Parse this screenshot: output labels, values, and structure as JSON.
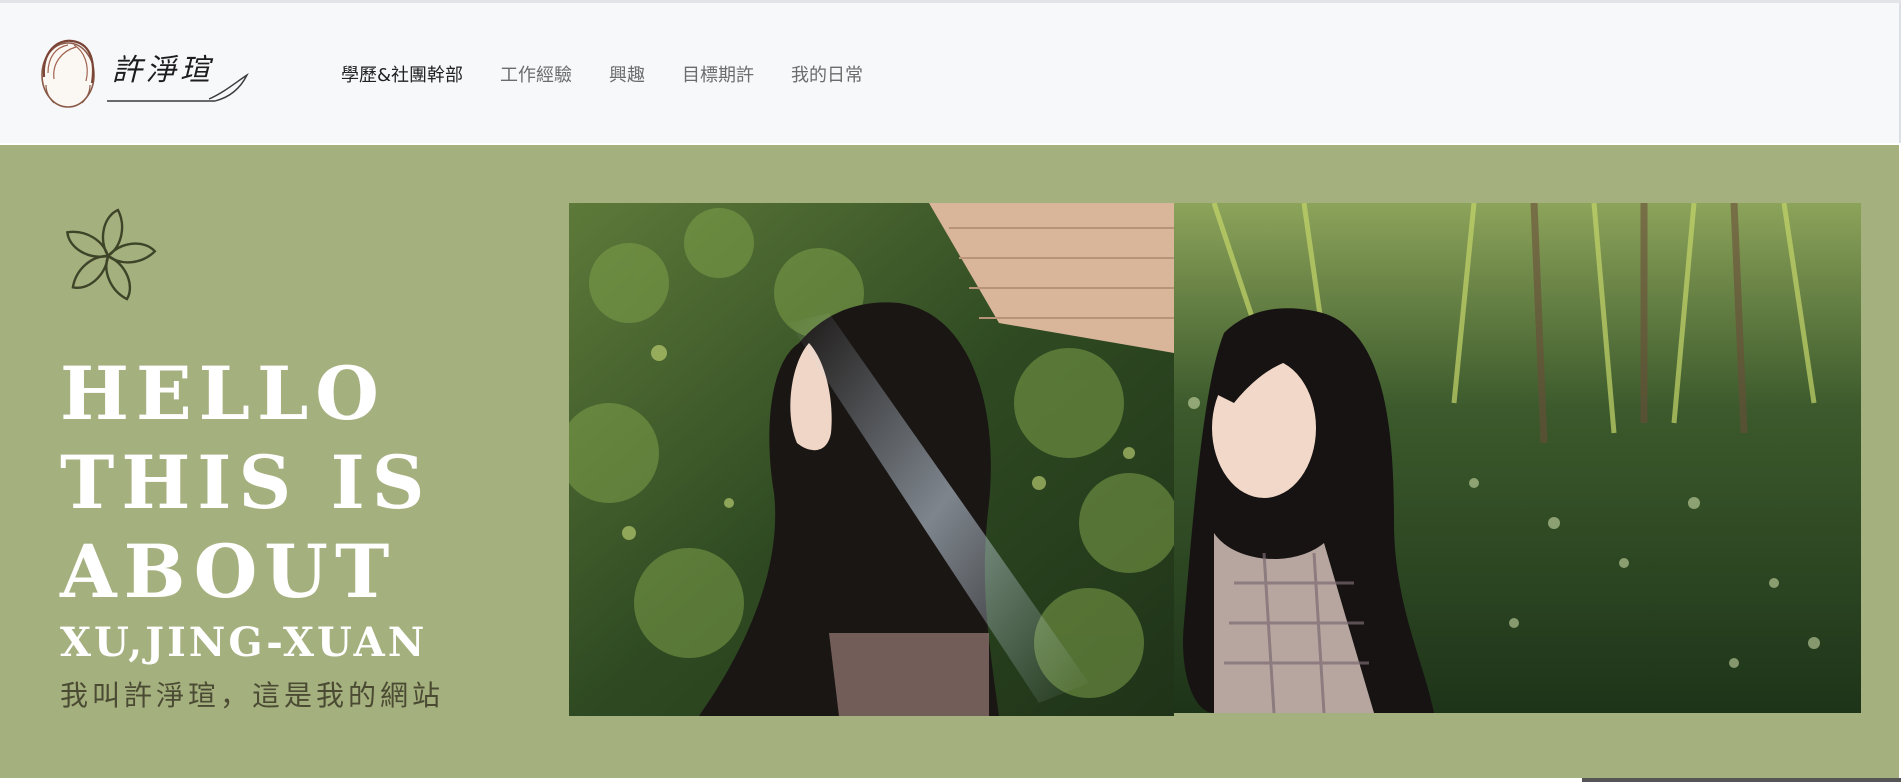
{
  "header": {
    "logo_text": "許淨瑄",
    "nav": [
      {
        "label": "學歷&社團幹部",
        "active": true
      },
      {
        "label": "工作經驗",
        "active": false
      },
      {
        "label": "興趣",
        "active": false
      },
      {
        "label": "目標期許",
        "active": false
      },
      {
        "label": "我的日常",
        "active": false
      }
    ]
  },
  "hero": {
    "icon": "flower-outline-icon",
    "headline_lines": [
      "HELLO",
      "THIS IS",
      "ABOUT"
    ],
    "name": "XU,JING-XUAN",
    "subtitle": "我叫許淨瑄，這是我的網站",
    "background_color": "#a5b07f",
    "photos": [
      {
        "description_icon": "profile-photo-side"
      },
      {
        "description_icon": "profile-photo-front"
      }
    ]
  }
}
